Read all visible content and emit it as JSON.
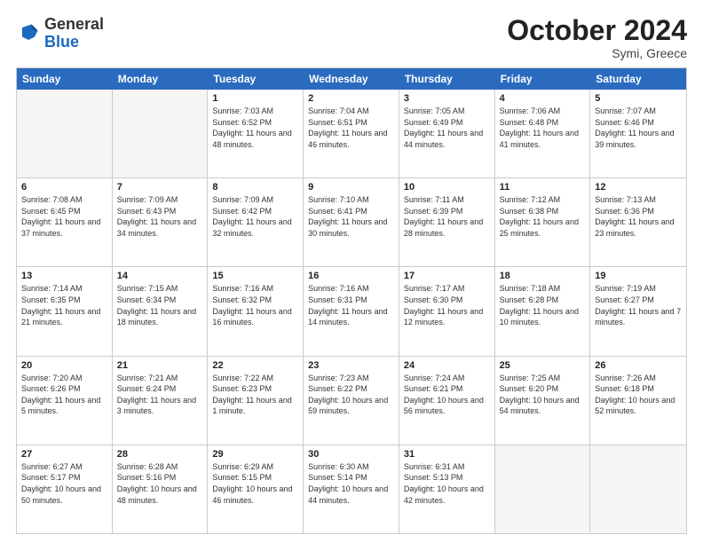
{
  "logo": {
    "general": "General",
    "blue": "Blue"
  },
  "header": {
    "month": "October 2024",
    "location": "Symi, Greece"
  },
  "weekdays": [
    "Sunday",
    "Monday",
    "Tuesday",
    "Wednesday",
    "Thursday",
    "Friday",
    "Saturday"
  ],
  "rows": [
    [
      {
        "day": "",
        "empty": true
      },
      {
        "day": "",
        "empty": true
      },
      {
        "day": "1",
        "sunrise": "Sunrise: 7:03 AM",
        "sunset": "Sunset: 6:52 PM",
        "daylight": "Daylight: 11 hours and 48 minutes."
      },
      {
        "day": "2",
        "sunrise": "Sunrise: 7:04 AM",
        "sunset": "Sunset: 6:51 PM",
        "daylight": "Daylight: 11 hours and 46 minutes."
      },
      {
        "day": "3",
        "sunrise": "Sunrise: 7:05 AM",
        "sunset": "Sunset: 6:49 PM",
        "daylight": "Daylight: 11 hours and 44 minutes."
      },
      {
        "day": "4",
        "sunrise": "Sunrise: 7:06 AM",
        "sunset": "Sunset: 6:48 PM",
        "daylight": "Daylight: 11 hours and 41 minutes."
      },
      {
        "day": "5",
        "sunrise": "Sunrise: 7:07 AM",
        "sunset": "Sunset: 6:46 PM",
        "daylight": "Daylight: 11 hours and 39 minutes."
      }
    ],
    [
      {
        "day": "6",
        "sunrise": "Sunrise: 7:08 AM",
        "sunset": "Sunset: 6:45 PM",
        "daylight": "Daylight: 11 hours and 37 minutes."
      },
      {
        "day": "7",
        "sunrise": "Sunrise: 7:09 AM",
        "sunset": "Sunset: 6:43 PM",
        "daylight": "Daylight: 11 hours and 34 minutes."
      },
      {
        "day": "8",
        "sunrise": "Sunrise: 7:09 AM",
        "sunset": "Sunset: 6:42 PM",
        "daylight": "Daylight: 11 hours and 32 minutes."
      },
      {
        "day": "9",
        "sunrise": "Sunrise: 7:10 AM",
        "sunset": "Sunset: 6:41 PM",
        "daylight": "Daylight: 11 hours and 30 minutes."
      },
      {
        "day": "10",
        "sunrise": "Sunrise: 7:11 AM",
        "sunset": "Sunset: 6:39 PM",
        "daylight": "Daylight: 11 hours and 28 minutes."
      },
      {
        "day": "11",
        "sunrise": "Sunrise: 7:12 AM",
        "sunset": "Sunset: 6:38 PM",
        "daylight": "Daylight: 11 hours and 25 minutes."
      },
      {
        "day": "12",
        "sunrise": "Sunrise: 7:13 AM",
        "sunset": "Sunset: 6:36 PM",
        "daylight": "Daylight: 11 hours and 23 minutes."
      }
    ],
    [
      {
        "day": "13",
        "sunrise": "Sunrise: 7:14 AM",
        "sunset": "Sunset: 6:35 PM",
        "daylight": "Daylight: 11 hours and 21 minutes."
      },
      {
        "day": "14",
        "sunrise": "Sunrise: 7:15 AM",
        "sunset": "Sunset: 6:34 PM",
        "daylight": "Daylight: 11 hours and 18 minutes."
      },
      {
        "day": "15",
        "sunrise": "Sunrise: 7:16 AM",
        "sunset": "Sunset: 6:32 PM",
        "daylight": "Daylight: 11 hours and 16 minutes."
      },
      {
        "day": "16",
        "sunrise": "Sunrise: 7:16 AM",
        "sunset": "Sunset: 6:31 PM",
        "daylight": "Daylight: 11 hours and 14 minutes."
      },
      {
        "day": "17",
        "sunrise": "Sunrise: 7:17 AM",
        "sunset": "Sunset: 6:30 PM",
        "daylight": "Daylight: 11 hours and 12 minutes."
      },
      {
        "day": "18",
        "sunrise": "Sunrise: 7:18 AM",
        "sunset": "Sunset: 6:28 PM",
        "daylight": "Daylight: 11 hours and 10 minutes."
      },
      {
        "day": "19",
        "sunrise": "Sunrise: 7:19 AM",
        "sunset": "Sunset: 6:27 PM",
        "daylight": "Daylight: 11 hours and 7 minutes."
      }
    ],
    [
      {
        "day": "20",
        "sunrise": "Sunrise: 7:20 AM",
        "sunset": "Sunset: 6:26 PM",
        "daylight": "Daylight: 11 hours and 5 minutes."
      },
      {
        "day": "21",
        "sunrise": "Sunrise: 7:21 AM",
        "sunset": "Sunset: 6:24 PM",
        "daylight": "Daylight: 11 hours and 3 minutes."
      },
      {
        "day": "22",
        "sunrise": "Sunrise: 7:22 AM",
        "sunset": "Sunset: 6:23 PM",
        "daylight": "Daylight: 11 hours and 1 minute."
      },
      {
        "day": "23",
        "sunrise": "Sunrise: 7:23 AM",
        "sunset": "Sunset: 6:22 PM",
        "daylight": "Daylight: 10 hours and 59 minutes."
      },
      {
        "day": "24",
        "sunrise": "Sunrise: 7:24 AM",
        "sunset": "Sunset: 6:21 PM",
        "daylight": "Daylight: 10 hours and 56 minutes."
      },
      {
        "day": "25",
        "sunrise": "Sunrise: 7:25 AM",
        "sunset": "Sunset: 6:20 PM",
        "daylight": "Daylight: 10 hours and 54 minutes."
      },
      {
        "day": "26",
        "sunrise": "Sunrise: 7:26 AM",
        "sunset": "Sunset: 6:18 PM",
        "daylight": "Daylight: 10 hours and 52 minutes."
      }
    ],
    [
      {
        "day": "27",
        "sunrise": "Sunrise: 6:27 AM",
        "sunset": "Sunset: 5:17 PM",
        "daylight": "Daylight: 10 hours and 50 minutes."
      },
      {
        "day": "28",
        "sunrise": "Sunrise: 6:28 AM",
        "sunset": "Sunset: 5:16 PM",
        "daylight": "Daylight: 10 hours and 48 minutes."
      },
      {
        "day": "29",
        "sunrise": "Sunrise: 6:29 AM",
        "sunset": "Sunset: 5:15 PM",
        "daylight": "Daylight: 10 hours and 46 minutes."
      },
      {
        "day": "30",
        "sunrise": "Sunrise: 6:30 AM",
        "sunset": "Sunset: 5:14 PM",
        "daylight": "Daylight: 10 hours and 44 minutes."
      },
      {
        "day": "31",
        "sunrise": "Sunrise: 6:31 AM",
        "sunset": "Sunset: 5:13 PM",
        "daylight": "Daylight: 10 hours and 42 minutes."
      },
      {
        "day": "",
        "empty": true
      },
      {
        "day": "",
        "empty": true
      }
    ]
  ]
}
